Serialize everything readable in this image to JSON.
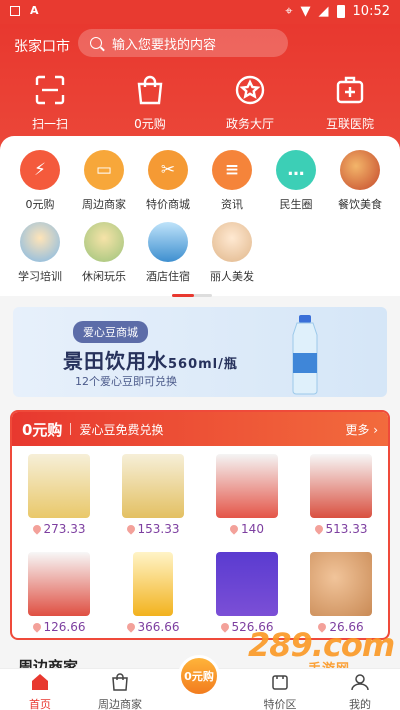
{
  "status_bar": {
    "time": "10:52"
  },
  "header": {
    "city": "张家口市",
    "search_placeholder": "输入您要找的内容",
    "nav": [
      {
        "label": "扫一扫",
        "icon": "scan-icon"
      },
      {
        "label": "0元购",
        "icon": "shopping-bag-icon"
      },
      {
        "label": "政务大厅",
        "icon": "star-badge-icon"
      },
      {
        "label": "互联医院",
        "icon": "medical-kit-icon"
      }
    ]
  },
  "categories": [
    {
      "label": "0元购",
      "icon": "lightning-icon",
      "color": "#f45a3c"
    },
    {
      "label": "周边商家",
      "icon": "store-box-icon",
      "color": "#f7a73a"
    },
    {
      "label": "特价商城",
      "icon": "ticket-icon",
      "color": "#f59a34"
    },
    {
      "label": "资讯",
      "icon": "news-icon",
      "color": "#f5843a"
    },
    {
      "label": "民生圈",
      "icon": "chat-icon",
      "color": "#3ccfb6"
    },
    {
      "label": "餐饮美食",
      "icon": "food-photo-icon",
      "color": "#d9643e"
    },
    {
      "label": "学习培训",
      "icon": "study-photo-icon",
      "color": "#7fb7e6"
    },
    {
      "label": "休闲玩乐",
      "icon": "leisure-photo-icon",
      "color": "#9cc37a"
    },
    {
      "label": "酒店住宿",
      "icon": "hotel-photo-icon",
      "color": "#5aa8d8"
    },
    {
      "label": "丽人美发",
      "icon": "beauty-photo-icon",
      "color": "#e8c7a6"
    }
  ],
  "banner": {
    "tag": "爱心豆商城",
    "title": "景田饮用水",
    "title_unit": "560ml/瓶",
    "subtitle": "12个爱心豆即可兑换"
  },
  "zero_buy": {
    "title": "0元购",
    "subtitle": "爱心豆免费兑换",
    "more": "更多 ›",
    "products": [
      {
        "price": "273.33",
        "color": "#e9c86a"
      },
      {
        "price": "153.33",
        "color": "#e3c062"
      },
      {
        "price": "140",
        "color": "#e45548"
      },
      {
        "price": "513.33",
        "color": "#d95040"
      },
      {
        "price": "126.66",
        "color": "#df4f42"
      },
      {
        "price": "366.66",
        "color": "#f2b21e"
      },
      {
        "price": "526.66",
        "color": "#7b4fd6"
      },
      {
        "price": "26.66",
        "color": "#c98a55"
      }
    ]
  },
  "next_section": "周边商家",
  "bottom_nav": [
    {
      "label": "首页",
      "icon": "home-icon",
      "active": true
    },
    {
      "label": "周边商家",
      "icon": "shopping-bag-icon",
      "active": false
    },
    {
      "label": "0元购",
      "icon": "zero-buy-center-icon",
      "active": false
    },
    {
      "label": "特价区",
      "icon": "sale-icon",
      "active": false
    },
    {
      "label": "我的",
      "icon": "profile-icon",
      "active": false
    }
  ],
  "watermark": {
    "main": "289.com",
    "sub": "手游网"
  }
}
